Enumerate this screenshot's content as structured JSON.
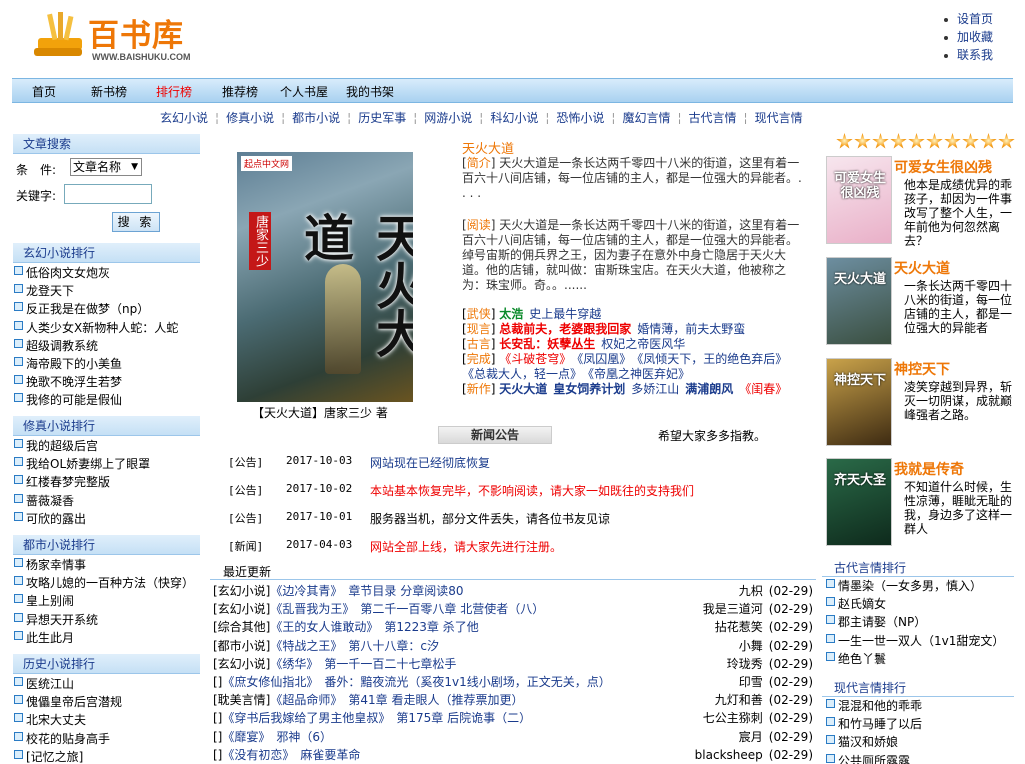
{
  "header": {
    "logo_text": "百书库",
    "logo_sub": "WWW.BAISHUKU.COM",
    "links": [
      "设首页",
      "加收藏",
      "联系我"
    ]
  },
  "nav": [
    "首页",
    "新书榜",
    "排行榜",
    "推荐榜",
    "个人书屋",
    "我的书架"
  ],
  "categories": [
    "玄幻小说",
    "修真小说",
    "都市小说",
    "历史军事",
    "网游小说",
    "科幻小说",
    "恐怖小说",
    "魔幻言情",
    "古代言情",
    "现代言情"
  ],
  "search": {
    "title": "文章搜索",
    "cond_label": "条　件:",
    "cond_value": "文章名称",
    "kw_label": "关键字:",
    "button": "搜 索"
  },
  "left_lists": [
    {
      "title": "玄幻小说排行",
      "items": [
        "低俗肉文女炮灰",
        "龙登天下",
        "反正我是在做梦（np）",
        "人类少女X新物种人蛇：人蛇",
        "超级调教系统",
        "海帝殿下的小美鱼",
        "挽歌不晚浮生若梦",
        "我修的可能是假仙"
      ]
    },
    {
      "title": "修真小说排行",
      "items": [
        "我的超级后宫",
        "我给OL娇妻绑上了眼罩",
        "红楼春梦完整版",
        "蔷薇凝香",
        "可欣的露出"
      ]
    },
    {
      "title": "都市小说排行",
      "items": [
        "杨家幸情事",
        "攻略儿媳的一百种方法（快穿）",
        "皇上别闹",
        "异想天开系统",
        "此生此月"
      ]
    },
    {
      "title": "历史小说排行",
      "items": [
        "医统江山",
        "傀儡皇帝后宫潜规",
        "北宋大丈夫",
        "校花的贴身高手",
        "[记忆之旅]"
      ]
    }
  ],
  "featured": {
    "cover_publisher": "起点中文网",
    "cover_author": "唐家三少",
    "cover_title": "天火大道",
    "caption": "【天火大道】唐家三少 著",
    "title": "天火大道",
    "intro_tag": "简介",
    "intro": "天火大道是一条长达两千零四十八米的街道，这里有着一百六十八间店铺，每一位店铺的主人，都是一位强大的异能者。. . . .",
    "read_tag": "阅读",
    "read": "天火大道是一条长达两千零四十八米的街道，这里有着一百六十八间店铺，每一位店铺的主人，都是一位强大的异能者。绰号宙斯的佣兵界之王，因为妻子在意外中身亡隐居于天火大道。他的店铺，就叫做：宙斯珠宝店。在天火大道，他被称之为：珠宝师。奇。。......"
  },
  "genre_rows": [
    {
      "tag": "武侠",
      "items": [
        {
          "text": "太浩",
          "style": "green"
        },
        {
          "text": "史上最牛穿越",
          "style": "link"
        }
      ]
    },
    {
      "tag": "现言",
      "items": [
        {
          "text": "总裁前夫，老婆跟我回家",
          "style": "red-bold"
        },
        {
          "text": "婚情薄，前夫太野蛮",
          "style": "link"
        }
      ]
    },
    {
      "tag": "古言",
      "items": [
        {
          "text": "长安乱：妖孽丛生",
          "style": "red-bold"
        },
        {
          "text": "权妃之帝医风华",
          "style": "link"
        }
      ]
    },
    {
      "tag": "完成",
      "items": [
        {
          "text": "《斗破苍穹》",
          "style": "red"
        },
        {
          "text": "《凤囚凰》",
          "style": "link"
        },
        {
          "text": "《凤倾天下，王的绝色弃后》",
          "style": "link"
        }
      ]
    },
    {
      "tag": "",
      "items": [
        {
          "text": "《总裁大人，轻一点》",
          "style": "link"
        },
        {
          "text": "《帝凰之神医弃妃》",
          "style": "link"
        }
      ]
    },
    {
      "tag": "新作",
      "items": [
        {
          "text": "天火大道",
          "style": "bold-link"
        },
        {
          "text": "皇女饲养计划",
          "style": "bold-link"
        },
        {
          "text": "多娇江山",
          "style": "link"
        },
        {
          "text": "满浦朗风",
          "style": "bold-link"
        },
        {
          "text": "《闺春》",
          "style": "red"
        }
      ]
    }
  ],
  "news": {
    "title": "新闻公告",
    "note": "希望大家多多指教。",
    "rows": [
      {
        "type": "[公告]",
        "date": "2017-10-03",
        "text": "网站现在已经彻底恢复",
        "style": "link"
      },
      {
        "type": "[公告]",
        "date": "2017-10-02",
        "text": "本站基本恢复完毕，不影响阅读，请大家一如既往的支持我们",
        "style": "red"
      },
      {
        "type": "[公告]",
        "date": "2017-10-01",
        "text": "服务器当机，部分文件丢失，请各位书友见谅",
        "style": "plain"
      },
      {
        "type": "[新闻]",
        "date": "2017-04-03",
        "text": "网站全部上线，请大家先进行注册。",
        "style": "red"
      }
    ]
  },
  "recent": {
    "title": "最近更新",
    "rows": [
      {
        "cat": "[玄幻小说]",
        "book": "《边冷其青》",
        "chapter": "章节目录 分章阅读80",
        "author": "九枳",
        "date": "(02-29)"
      },
      {
        "cat": "[玄幻小说]",
        "book": "《乱晋我为王》",
        "chapter": "第二千一百零八章 北营使者（八）",
        "author": "我是三道河",
        "date": "(02-29)"
      },
      {
        "cat": "[综合其他]",
        "book": "《王的女人谁敢动》",
        "chapter": "第1223章 杀了他",
        "author": "拈花惹笑",
        "date": "(02-29)"
      },
      {
        "cat": "[都市小说]",
        "book": "《特战之王》",
        "chapter": "第八十八章：c汐",
        "author": "小舞",
        "date": "(02-29)"
      },
      {
        "cat": "[玄幻小说]",
        "book": "《绣华》",
        "chapter": "第一千一百二十七章松手",
        "author": "玲珑秀",
        "date": "(02-29)"
      },
      {
        "cat": "[]",
        "book": "《庶女修仙指北》",
        "chapter": "番外：黯夜流光（奚夜1v1线小剧场，正文无关，点）",
        "author": "印雪",
        "date": "(02-29)"
      },
      {
        "cat": "[耽美言情]",
        "book": "《超品命师》",
        "chapter": "第41章 看走眼人（推荐票加更）",
        "author": "九灯和善",
        "date": "(02-29)"
      },
      {
        "cat": "[]",
        "book": "《穿书后我嫁给了男主他皇叔》",
        "chapter": "第175章 后院诡事（二）",
        "author": "七公主猕刺",
        "date": "(02-29)"
      },
      {
        "cat": "[]",
        "book": "《靡宴》",
        "chapter": "邪神（6）",
        "author": "宸月",
        "date": "(02-29)"
      },
      {
        "cat": "[]",
        "book": "《没有初恋》",
        "chapter": "麻雀要革命",
        "author": "blacksheep",
        "date": "(02-29)"
      }
    ]
  },
  "right_features": [
    {
      "title": "可爱女生很凶残",
      "desc": "他本是成绩优异的乖孩子，却因为一件事改写了整个人生，一年前他为何忽然离去？",
      "thumb_text": "可爱女生很凶残",
      "color1": "#f7e6ee",
      "color2": "#e9b0c8"
    },
    {
      "title": "天火大道",
      "desc": "一条长达两千零四十八米的街道，每一位店铺的主人，都是一位强大的异能者",
      "thumb_text": "天火大道",
      "color1": "#6d8ea0",
      "color2": "#3a4f40"
    },
    {
      "title": "神控天下",
      "desc": "凌笑穿越到异界，斩灭一切阴谋，成就巅峰强者之路。",
      "thumb_text": "神控天下",
      "color1": "#c9a24a",
      "color2": "#3e2b12"
    },
    {
      "title": "我就是传奇",
      "desc": "不知道什么时候，生性凉薄，睚眦无耻的我，身边多了这样一群人",
      "thumb_text": "齐天大圣",
      "color1": "#2a6a48",
      "color2": "#0e2a1c"
    }
  ],
  "right_lists": [
    {
      "title": "古代言情排行",
      "items": [
        "情墨染（一女多男，慎入）",
        "赵氏嫡女",
        "郡主请娶（NP）",
        "一生一世一双人（1v1甜宠文）",
        "绝色丫鬟"
      ]
    },
    {
      "title": "现代言情排行",
      "items": [
        "混混和他的乖乖",
        "和竹马睡了以后",
        "猫汉和娇娘",
        "公共厕所露露"
      ]
    }
  ]
}
